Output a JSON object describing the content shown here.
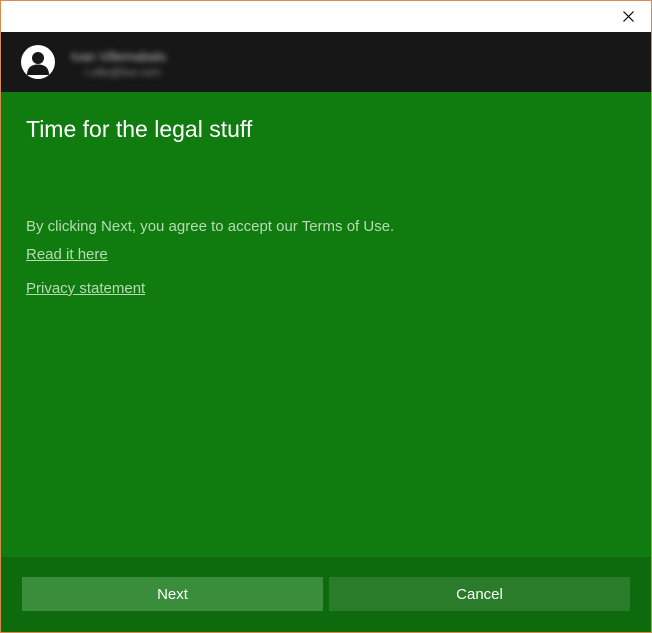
{
  "account": {
    "name": "Ivan Villemabalo",
    "email": "i.ville@live.com"
  },
  "main": {
    "title": "Time for the legal stuff",
    "terms_text": "By clicking Next, you agree to accept our Terms of Use.",
    "read_link": "Read it here",
    "privacy_link": "Privacy statement"
  },
  "footer": {
    "next_label": "Next",
    "cancel_label": "Cancel"
  },
  "icons": {
    "close": "close-icon",
    "avatar": "person-icon"
  },
  "colors": {
    "content_bg": "#107c10",
    "footer_bg": "#0d6a0d",
    "account_bar_bg": "#171717",
    "next_button_bg": "#3a8d3a",
    "cancel_button_bg": "#2a7b2a",
    "muted_text": "#b8dbb4"
  }
}
